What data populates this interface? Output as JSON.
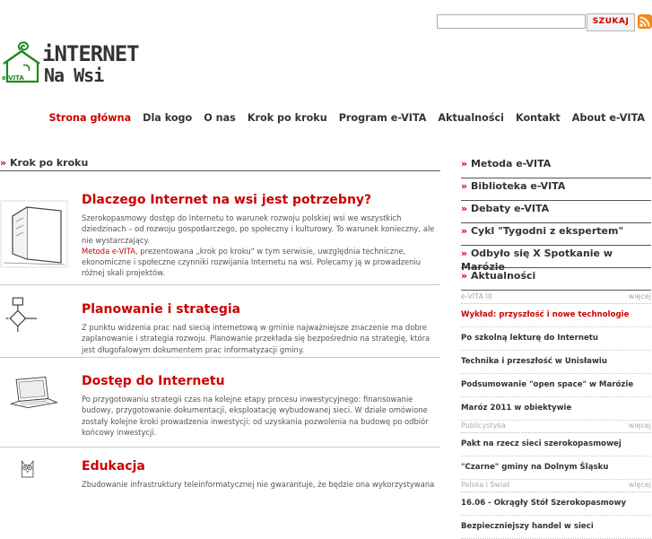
{
  "search": {
    "value": "",
    "button_label": "SZUKAJ"
  },
  "logo": {
    "line1": "iNTERNET",
    "line2": "Na Wsi",
    "badge": "e-VITA"
  },
  "nav": [
    {
      "label": "Strona główna",
      "active": true
    },
    {
      "label": "Dla kogo"
    },
    {
      "label": "O nas"
    },
    {
      "label": "Krok po kroku"
    },
    {
      "label": "Program e-VITA"
    },
    {
      "label": "Aktualności"
    },
    {
      "label": "Kontakt"
    },
    {
      "label": "About e-VITA"
    }
  ],
  "main": {
    "section_title": "Krok po kroku",
    "arrow": "»",
    "articles": [
      {
        "title": "Dlaczego Internet na wsi jest potrzebny?",
        "text": "Szerokopasmowy dostęp do Internetu to warunek rozwoju polskiej wsi we wszystkich dziedzinach – od rozwoju gospodarczego, po społeczny i kulturowy. To warunek konieczny, ale nie wystarczający.",
        "link": "Metoda e-VITA",
        "text2": ", prezentowana „krok po kroku\" w tym serwisie, uwzględnia techniczne, ekonomiczne i społeczne czynniki rozwijania Internetu na wsi. Polecamy ją w prowadzeniu różnej skali projektów."
      },
      {
        "title": "Planowanie i strategia",
        "text": "Z punktu widzenia prac nad siecią internetową w gminie najważniejsze znaczenie ma dobre zaplanowanie i strategia rozwoju. Planowanie przekłada się bezpośrednio na strategię, która jest długofalowym dokumentem prac informatyzacji gminy."
      },
      {
        "title": "Dostęp do Internetu",
        "text": "Po przygotowaniu strategii czas na kolejne etapy procesu inwestycyjnego: finansowanie budowy, przygotowanie dokumentacji, eksploatację wybudowanej sieci. W dziale omówione zostały kolejne kroki prowadzenia inwestycji: od uzyskania pozwolenia na budowę po odbiór końcowy inwestycji."
      },
      {
        "title": "Edukacja",
        "text": "Zbudowanie infrastruktury teleinformatycznej nie gwarantuje, że będzie ona wykorzystywana"
      }
    ]
  },
  "sidebar": {
    "items": [
      "Metoda e-VITA",
      "Biblioteka e-VITA",
      "Debaty e-VITA",
      "Cykl \"Tygodni z ekspertem\"",
      "Odbyło się X Spotkanie w Marózie",
      "Aktualności"
    ],
    "more_label": "więcej",
    "groups": [
      {
        "head": "e-VITA III",
        "links": [
          "Wykład: przyszłość i nowe technologie",
          "Po szkolną lekturę do Internetu",
          "Technika i przeszłość w Unisławiu",
          "Podsumowanie \"open space\" w Marózie",
          "Maróz 2011 w obiektywie"
        ]
      },
      {
        "head": "Publicystyka",
        "links": [
          "Pakt na rzecz sieci szerokopasmowej",
          "\"Czarne\" gminy na Dolnym Śląsku"
        ]
      },
      {
        "head": "Polska i Świat",
        "links": [
          "16.06 - Okrągły Stół Szerokopasmowy",
          "Bezpieczniejszy handel w sieci"
        ]
      }
    ]
  },
  "colors": {
    "accent": "#cc0000",
    "text": "#333333",
    "rss": "#f28a1b",
    "logo_green": "#1d8a1d"
  },
  "icons": [
    "rss-icon",
    "house-logo-icon",
    "door-icon",
    "flowchart-icon",
    "laptop-icon",
    "owl-icon"
  ]
}
